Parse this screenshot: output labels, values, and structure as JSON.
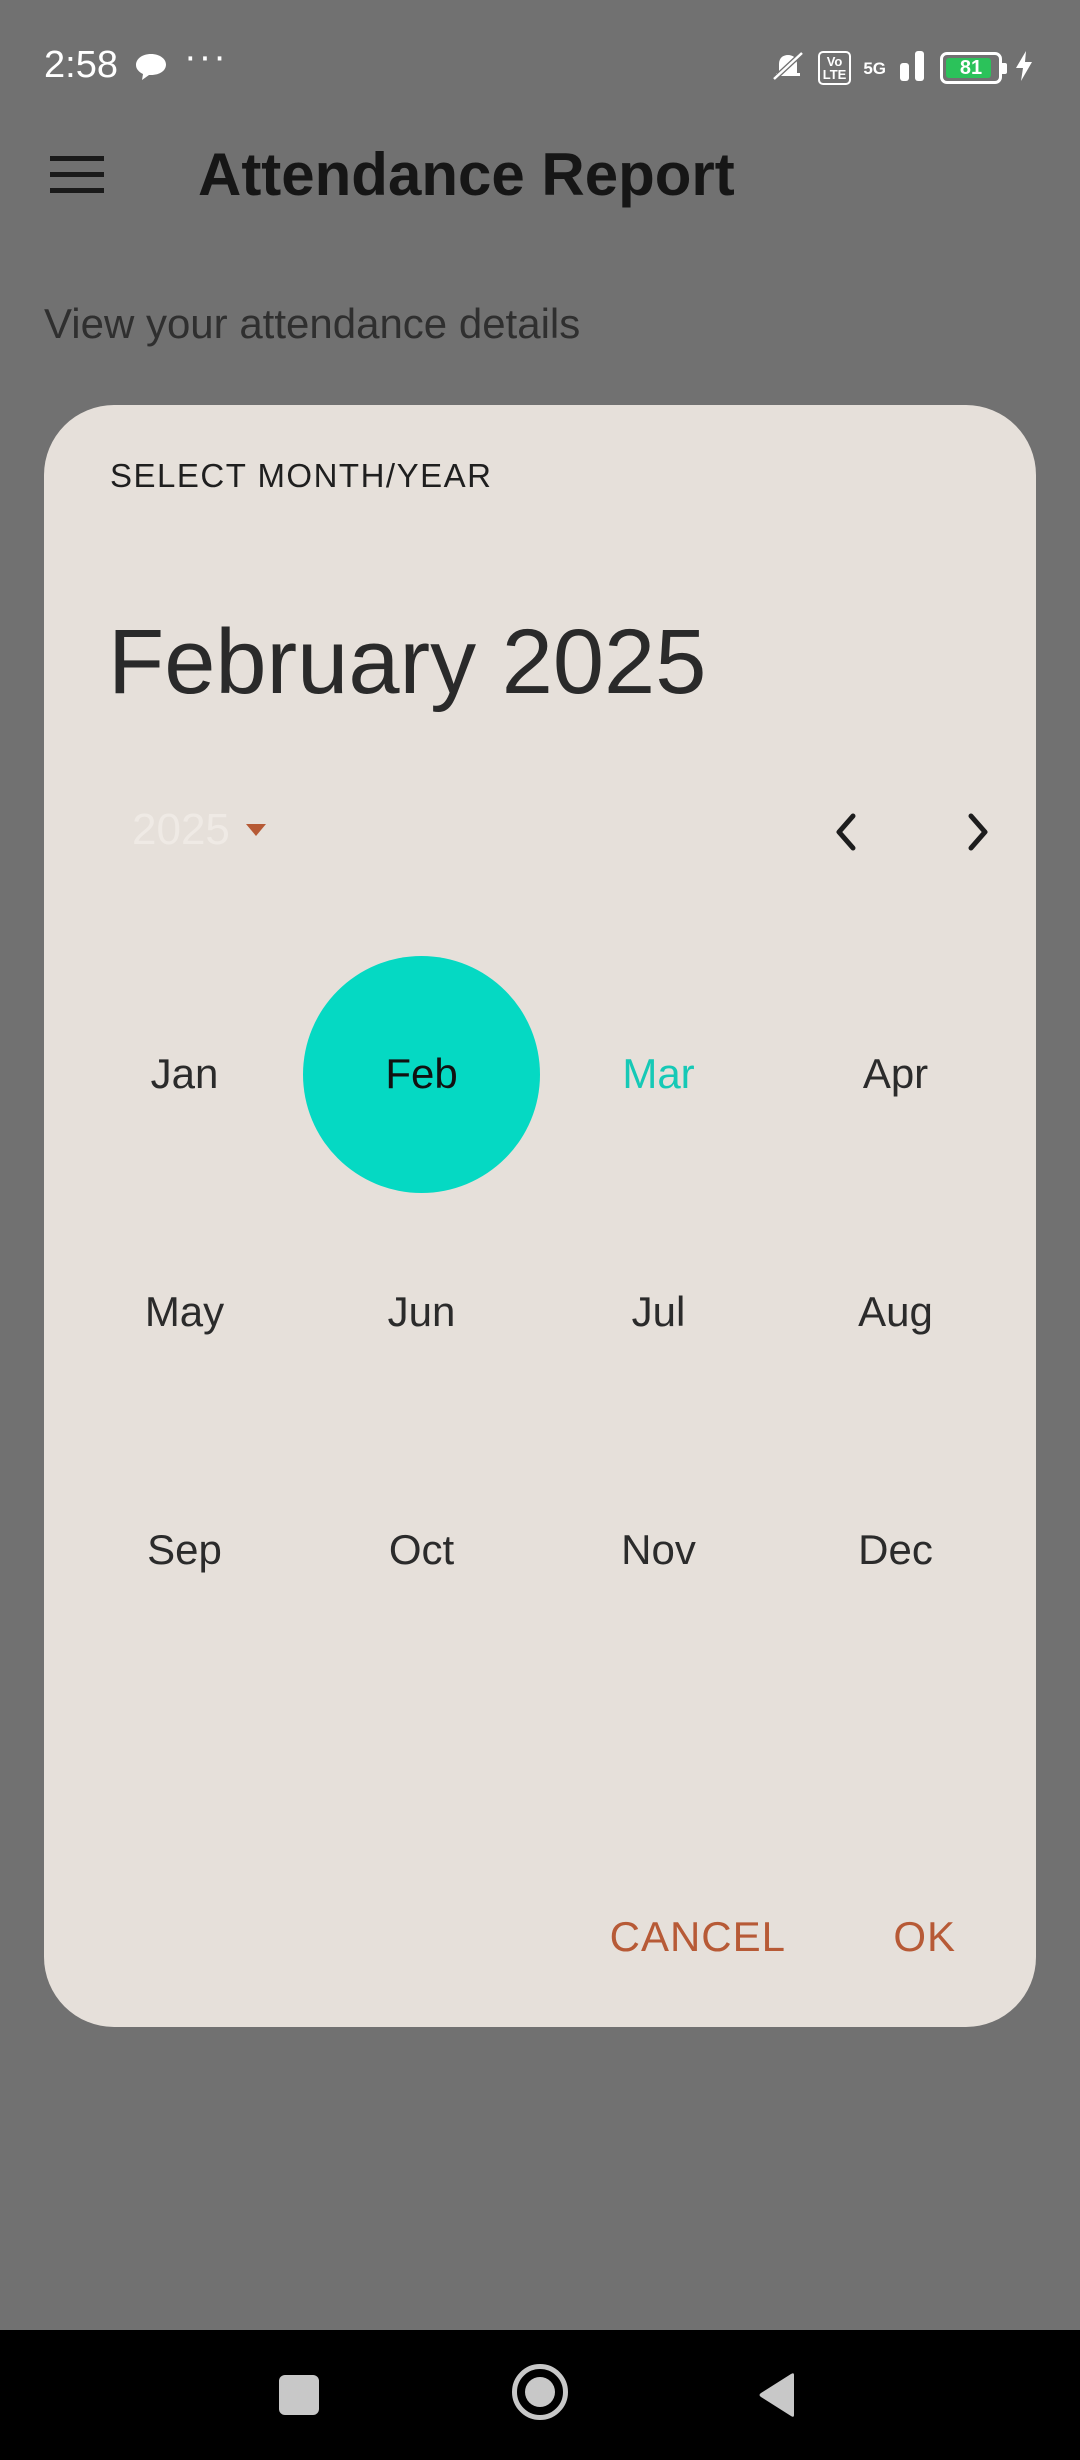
{
  "status_bar": {
    "time": "2:58",
    "more": "···",
    "volte_label": "Vo\nLTE",
    "network": "5G",
    "battery": "81",
    "battery_level_percent": 81
  },
  "app_bar": {
    "title": "Attendance Report",
    "menu_icon": "menu-icon"
  },
  "page": {
    "subtitle": "View your attendance details"
  },
  "dialog": {
    "header": "SELECT MONTH/YEAR",
    "selected_display": "February 2025",
    "year": "2025",
    "prev_icon": "chevron-left-icon",
    "next_icon": "chevron-right-icon",
    "months": [
      "Jan",
      "Feb",
      "Mar",
      "Apr",
      "May",
      "Jun",
      "Jul",
      "Aug",
      "Sep",
      "Oct",
      "Nov",
      "Dec"
    ],
    "selected_month": "Feb",
    "current_month": "Mar",
    "cancel_label": "CANCEL",
    "ok_label": "OK"
  },
  "colors": {
    "accent": "#05d9c3",
    "button_text": "#b75a36",
    "dialog_bg": "#e6e0da",
    "scrim": "#717171"
  }
}
